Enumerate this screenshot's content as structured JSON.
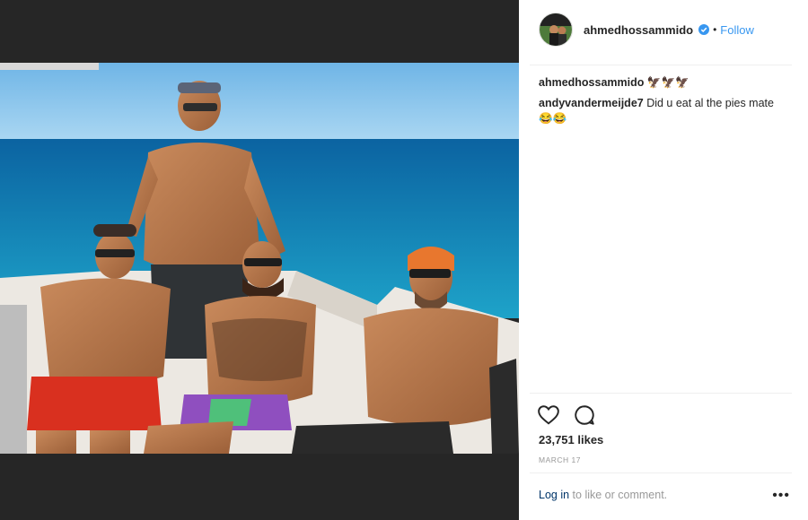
{
  "header": {
    "username": "ahmedhossammido",
    "dot": "•",
    "follow_label": "Follow"
  },
  "comments": [
    {
      "user": "ahmedhossammido",
      "text": "🦅🦅🦅"
    },
    {
      "user": "andyvandermeijde7",
      "text": "Did u eat al the pies mate 😂😂"
    }
  ],
  "likes": "23,751 likes",
  "date": "MARCH 17",
  "footer": {
    "login_label": "Log in",
    "login_suffix": "to like or comment.",
    "more_label": "•••"
  },
  "icons": {
    "like": "heart-icon",
    "comment": "speech-bubble-icon",
    "verified": "verified-badge-icon",
    "more": "more-options-icon"
  },
  "colors": {
    "link_blue": "#3897f0",
    "login_blue": "#003569",
    "muted_gray": "#999999",
    "media_backdrop": "#262626"
  }
}
